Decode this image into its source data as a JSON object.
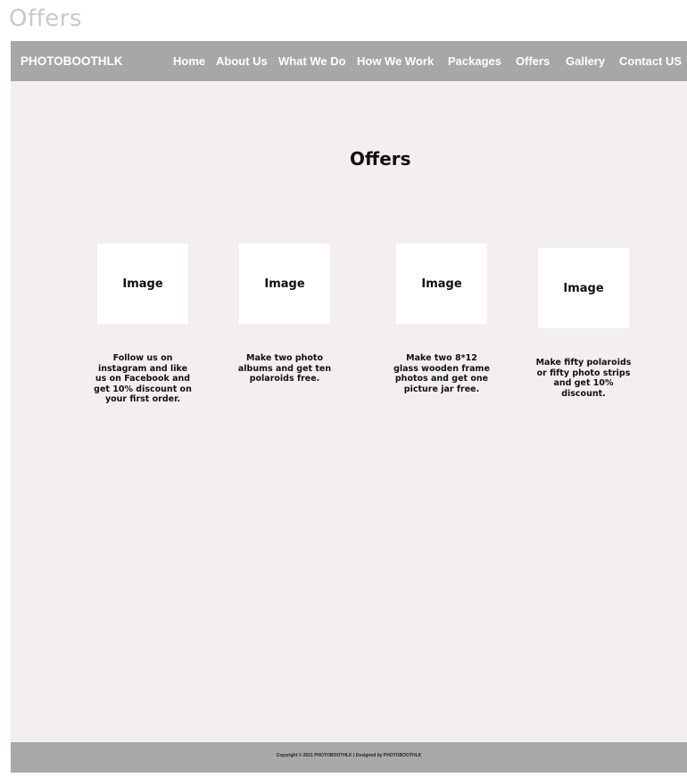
{
  "window": {
    "title": "Offers"
  },
  "navbar": {
    "brand": "PHOTOBOOTHLK",
    "items": [
      {
        "label": "Home"
      },
      {
        "label": "About Us"
      },
      {
        "label": "What We Do"
      },
      {
        "label": "How We Work"
      },
      {
        "label": "Packages"
      },
      {
        "label": "Offers"
      },
      {
        "label": "Gallery"
      },
      {
        "label": "Contact US"
      }
    ]
  },
  "main": {
    "heading": "Offers",
    "offers": [
      {
        "image_label": "Image",
        "description": "Follow us on instagram and like us on Facebook and get 10% discount on your first order."
      },
      {
        "image_label": "Image",
        "description": "Make two photo albums and get ten polaroids free."
      },
      {
        "image_label": "Image",
        "description": "Make two 8*12 glass wooden frame photos and get one picture jar free."
      },
      {
        "image_label": "Image",
        "description": "Make fifty polaroids or fifty photo strips and get 10% discount."
      }
    ]
  },
  "footer": {
    "text": "Copyright © 2021 PHOTOBOOTHLK | Designed by PHOTOBOOTHLK"
  },
  "colors": {
    "navbar_bg": "#a7a7a7",
    "page_bg": "#f2efee",
    "footer_bg": "#a9a9a9",
    "image_placeholder_bg": "#ffffff"
  }
}
